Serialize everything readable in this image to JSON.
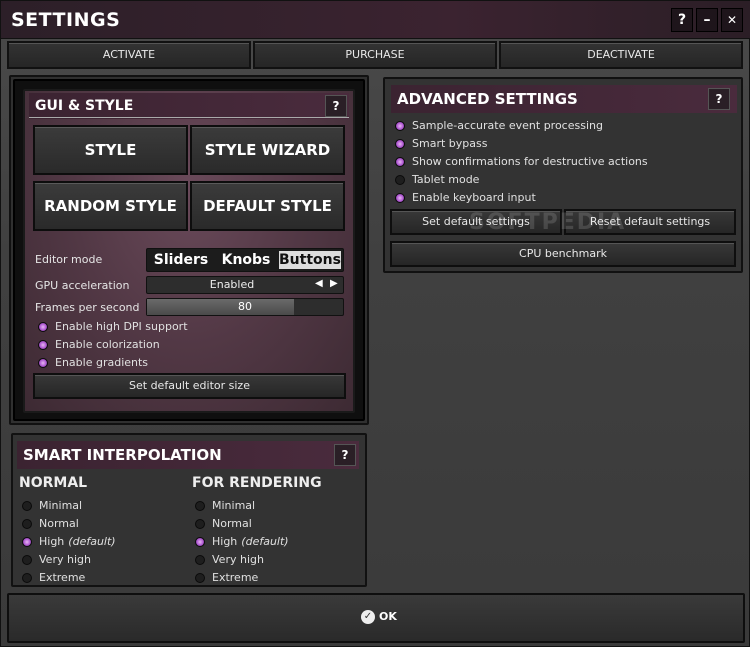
{
  "window": {
    "title": "SETTINGS",
    "help": "?",
    "minimize": "–",
    "close": "✕"
  },
  "topbar": {
    "activate": "ACTIVATE",
    "purchase": "PURCHASE",
    "deactivate": "DEACTIVATE"
  },
  "gui": {
    "title": "GUI & STYLE",
    "help": "?",
    "style": "STYLE",
    "style_wizard": "STYLE WIZARD",
    "random_style": "RANDOM STYLE",
    "default_style": "DEFAULT STYLE",
    "editor_mode_label": "Editor mode",
    "editor_modes": [
      "Sliders",
      "Knobs",
      "Buttons"
    ],
    "editor_mode_selected": "Buttons",
    "gpu_label": "GPU acceleration",
    "gpu_value": "Enabled",
    "fps_label": "Frames per second",
    "fps_value": "80",
    "fps_fraction": 0.75,
    "options": [
      {
        "label": "Enable high DPI support",
        "on": true
      },
      {
        "label": "Enable colorization",
        "on": true
      },
      {
        "label": "Enable gradients",
        "on": true
      }
    ],
    "set_default_size": "Set default editor size"
  },
  "advanced": {
    "title": "ADVANCED SETTINGS",
    "help": "?",
    "options": [
      {
        "label": "Sample-accurate event processing",
        "on": true
      },
      {
        "label": "Smart bypass",
        "on": true
      },
      {
        "label": "Show confirmations for destructive actions",
        "on": true
      },
      {
        "label": "Tablet mode",
        "on": false
      },
      {
        "label": "Enable keyboard input",
        "on": true
      }
    ],
    "set_default": "Set default settings",
    "reset_default": "Reset default settings",
    "cpu_benchmark": "CPU benchmark"
  },
  "interp": {
    "title": "SMART INTERPOLATION",
    "help": "?",
    "normal_title": "NORMAL",
    "render_title": "FOR RENDERING",
    "levels": [
      "Minimal",
      "Normal",
      "High",
      "Very high",
      "Extreme"
    ],
    "default_tag": "(default)",
    "normal_selected": 2,
    "render_selected": 2
  },
  "footer": {
    "ok": "OK"
  },
  "watermark": "SOFTPEDIA",
  "colors": {
    "accent": "#b05ad3",
    "header": "#3b2331"
  }
}
